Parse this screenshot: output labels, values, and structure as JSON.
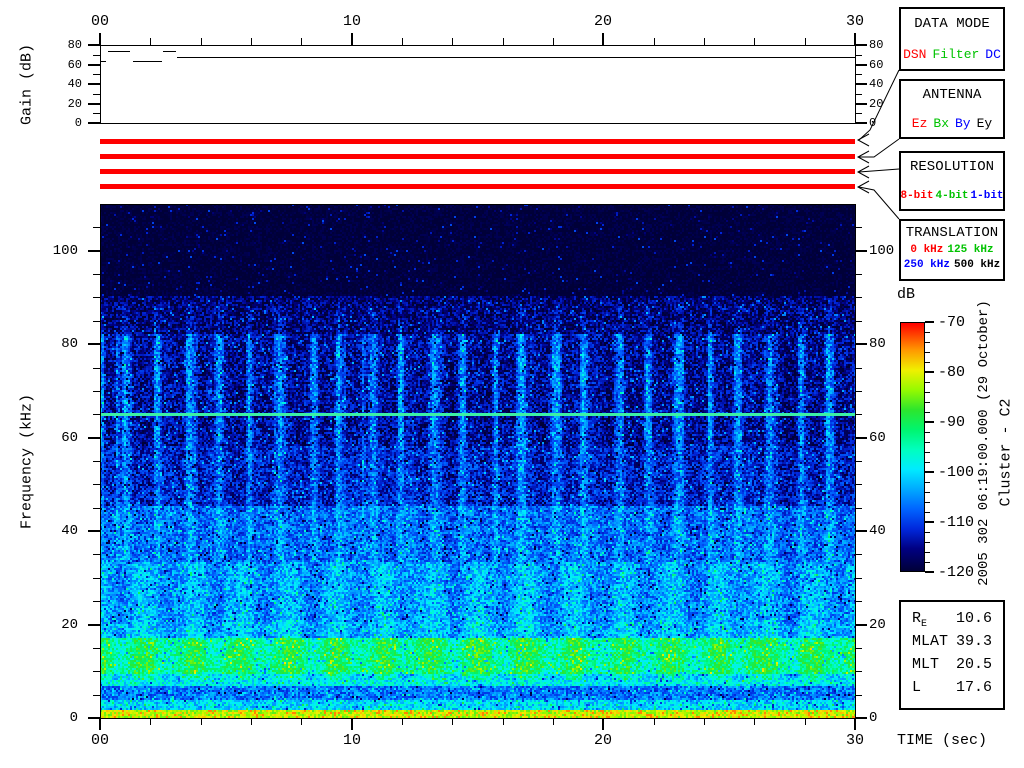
{
  "colors": {
    "red": "#ff0000",
    "green": "#00c300",
    "blue": "#0000ff",
    "black": "#000000",
    "status_bar": "#ff0000",
    "spec_bg": "#000038",
    "narrowband_line": "#3cf0a5"
  },
  "time_axis": {
    "tick_labels": [
      "00",
      "10",
      "20",
      "30"
    ],
    "minor_step_sec": 2
  },
  "gain_plot": {
    "ylabel": "Gain (dB)",
    "ytick_labels": [
      "0",
      "20",
      "40",
      "60",
      "80"
    ]
  },
  "spectrogram": {
    "ylabel": "Frequency (kHz)",
    "ytick_labels": [
      "0",
      "20",
      "40",
      "60",
      "80",
      "100"
    ]
  },
  "colorbar": {
    "title": "dB",
    "tick_labels": [
      "-70",
      "-80",
      "-90",
      "-100",
      "-110",
      "-120"
    ]
  },
  "side_text": {
    "datetime": "2005 302 06:19:00.000 (29 October)",
    "spacecraft": "Cluster - C2"
  },
  "bottom": {
    "xlabel": "TIME (sec)"
  },
  "panels": {
    "data_mode": {
      "title": "DATA MODE",
      "options": [
        {
          "label": "DSN",
          "color": "#ff0000"
        },
        {
          "label": "Filter",
          "color": "#00c300"
        },
        {
          "label": "DC",
          "color": "#0000ff"
        }
      ]
    },
    "antenna": {
      "title": "ANTENNA",
      "options": [
        {
          "label": "Ez",
          "color": "#ff0000"
        },
        {
          "label": "Bx",
          "color": "#00c300"
        },
        {
          "label": "By",
          "color": "#0000ff"
        },
        {
          "label": "Ey",
          "color": "#000000"
        }
      ]
    },
    "resolution": {
      "title": "RESOLUTION",
      "options": [
        {
          "label": "8-bit",
          "color": "#ff0000"
        },
        {
          "label": "4-bit",
          "color": "#00c300"
        },
        {
          "label": "1-bit",
          "color": "#0000ff"
        }
      ]
    },
    "translation": {
      "title": "TRANSLATION",
      "row1": [
        {
          "label": "0 kHz",
          "color": "#ff0000"
        },
        {
          "label": "125 kHz",
          "color": "#00c300"
        }
      ],
      "row2": [
        {
          "label": "250 kHz",
          "color": "#0000ff"
        },
        {
          "label": "500 kHz",
          "color": "#000000"
        }
      ]
    }
  },
  "ephemeris": {
    "rows": [
      {
        "label": "R",
        "sub": "E",
        "value": "10.6"
      },
      {
        "label": "MLAT",
        "sub": "",
        "value": "39.3"
      },
      {
        "label": "MLT",
        "sub": "",
        "value": "20.5"
      },
      {
        "label": "L",
        "sub": "",
        "value": "17.6"
      }
    ]
  },
  "chart_data": [
    {
      "type": "line",
      "title": "Receiver gain vs time",
      "xlabel": "TIME (sec)",
      "ylabel": "Gain (dB)",
      "xlim": [
        0,
        30
      ],
      "ylim": [
        0,
        80
      ],
      "x_ticks": [
        0,
        10,
        20,
        30
      ],
      "y_ticks": [
        0,
        20,
        40,
        60,
        80
      ],
      "series": [
        {
          "name": "gain",
          "step_segments": [
            [
              0.0,
              0.25,
              64
            ],
            [
              0.3,
              1.2,
              74
            ],
            [
              1.3,
              2.45,
              64
            ],
            [
              2.5,
              3.0,
              74
            ],
            [
              3.05,
              30.0,
              68
            ]
          ]
        }
      ]
    },
    {
      "type": "heatmap",
      "title": "Cluster WBD spectrogram",
      "xlabel": "TIME (sec)",
      "ylabel": "Frequency (kHz)",
      "xlim": [
        0,
        30
      ],
      "ylim": [
        0,
        110
      ],
      "colorbar": {
        "label": "dB",
        "min": -120,
        "max": -70,
        "ticks": [
          -70,
          -80,
          -90,
          -100,
          -110,
          -120
        ]
      },
      "band_profile_khz_db": [
        [
          0,
          1.3,
          -82
        ],
        [
          1.3,
          3.5,
          -101
        ],
        [
          3.5,
          6.5,
          -107
        ],
        [
          6.5,
          9,
          -99
        ],
        [
          9,
          17,
          -93
        ],
        [
          17,
          20.5,
          -103
        ],
        [
          20.5,
          33,
          -104.5
        ],
        [
          33,
          45,
          -108
        ],
        [
          45,
          58,
          -111.5
        ],
        [
          58,
          82,
          -114
        ],
        [
          82,
          90,
          -117
        ],
        [
          90,
          110,
          -119.5
        ]
      ],
      "features": [
        {
          "name": "narrowband-emission-line",
          "freq_khz": 65,
          "extent_sec": [
            0,
            30
          ]
        },
        {
          "name": "intense-bottom-band",
          "freq_khz": [
            0,
            1.3
          ],
          "level_db": -82
        },
        {
          "name": "green-emission-band",
          "freq_khz": [
            9,
            17
          ],
          "modulation_period_sec": 1.9
        },
        {
          "name": "vertical-plume-striations",
          "freq_khz": [
            45,
            82
          ],
          "spacing_sec": 1.22
        },
        {
          "name": "noise-floor",
          "level_db": -120
        }
      ]
    }
  ]
}
